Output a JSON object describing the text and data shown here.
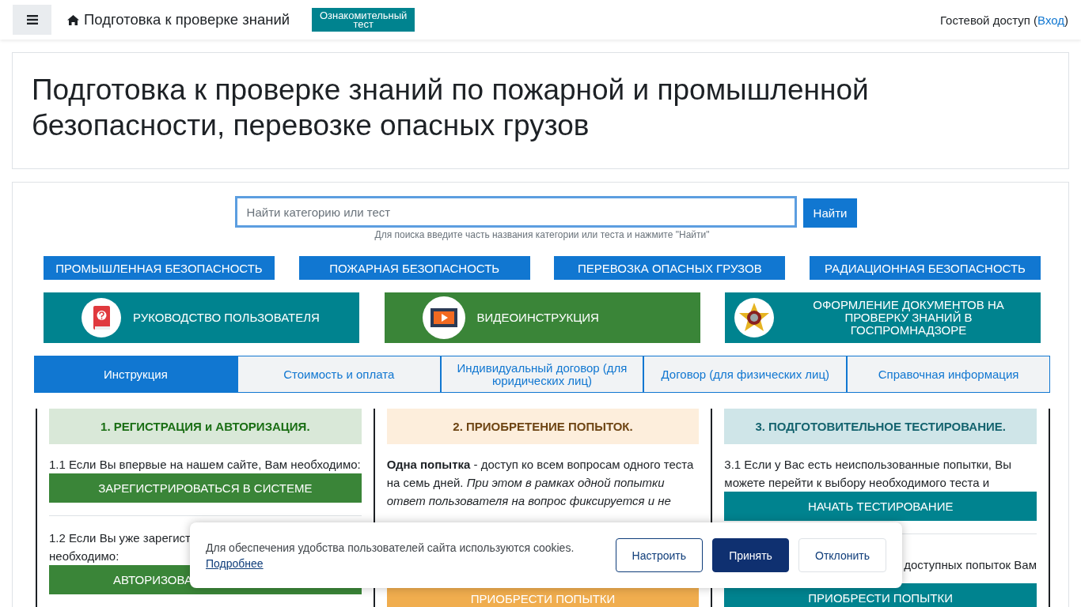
{
  "header": {
    "title": "Подготовка к проверке знаний",
    "badge": "Ознакомительный тест",
    "guest_prefix": "Гостевой доступ (",
    "login_link": "Вход",
    "guest_suffix": ")"
  },
  "hero": {
    "title": "Подготовка к проверке знаний по пожарной и промышленной безопасности, перевозке опасных грузов"
  },
  "search": {
    "placeholder": "Найти категорию или тест",
    "button": "Найти",
    "hint": "Для поиска введите часть названия категории или теста и нажмите \"Найти\""
  },
  "categories": [
    "ПРОМЫШЛЕННАЯ БЕЗОПАСНОСТЬ",
    "ПОЖАРНАЯ БЕЗОПАСНОСТЬ",
    "ПЕРЕВОЗКА ОПАСНЫХ ГРУЗОВ",
    "РАДИАЦИОННАЯ БЕЗОПАСНОСТЬ"
  ],
  "feature_buttons": [
    {
      "kind": "book",
      "label": "РУКОВОДСТВО ПОЛЬЗОВАТЕЛЯ",
      "color": "#00838f"
    },
    {
      "kind": "video",
      "label": "ВИДЕОИНСТРУКЦИЯ",
      "color": "#3a8538"
    },
    {
      "kind": "emblem",
      "label": "ОФОРМЛЕНИЕ ДОКУМЕНТОВ НА ПРОВЕРКУ ЗНАНИЙ В ГОСПРОМНАДЗОРЕ",
      "color": "#00838f"
    }
  ],
  "tabs": [
    {
      "label": "Инструкция",
      "selected": true
    },
    {
      "label": "Стоимость и оплата",
      "selected": false
    },
    {
      "label": "Индивидуальный договор (для юридических лиц)",
      "selected": false
    },
    {
      "label": "Договор (для физических лиц)",
      "selected": false
    },
    {
      "label": "Справочная информация",
      "selected": false
    }
  ],
  "columns": [
    {
      "color": "#d9e8d8",
      "heading": "1. РЕГИСТРАЦИЯ и АВТОРИЗАЦИЯ.",
      "blocks": [
        {
          "kind": "text",
          "lines": [
            "1.1 Если Вы впервые на нашем сайте, Вам необходимо:"
          ]
        },
        {
          "kind": "button",
          "label": "ЗАРЕГИСТРИРОВАТЬСЯ В СИСТЕМЕ",
          "color": "#3a8538"
        },
        {
          "kind": "divider"
        },
        {
          "kind": "text",
          "lines": [
            "1.2 Если Вы уже зарегист",
            "необходимо:"
          ]
        },
        {
          "kind": "button",
          "label": "АВТОРИЗОВА",
          "color": "#3a8538"
        }
      ]
    },
    {
      "color": "#fdeedc",
      "heading": "2. ПРИОБРЕТЕНИЕ ПОПЫТОК.",
      "blocks": [
        {
          "kind": "rich",
          "text": "**Одна попытка** - доступ ко всем вопросам одного теста на семь дней. *При этом в рамках одной попытки ответ пользователя на вопрос фиксируется и не*"
        },
        {
          "kind": "button",
          "label": "ПРИОБРЕСТИ ПОПЫТКИ",
          "color": "#f0ad4e"
        }
      ]
    },
    {
      "color": "#cfe5e8",
      "heading": "3. ПОДГОТОВИТЕЛЬНОЕ ТЕСТИРОВАНИЕ.",
      "blocks": [
        {
          "kind": "text",
          "lines": [
            "3.1 Если у Вас есть неиспользованные попытки, Вы можете перейти к выбору необходимого теста и"
          ]
        },
        {
          "kind": "button",
          "label": "НАЧАТЬ ТЕСТИРОВАНИЕ",
          "color": "#00838f"
        },
        {
          "kind": "divider"
        },
        {
          "kind": "fragment",
          "lines": [
            "доступных попыток Вам"
          ]
        },
        {
          "kind": "button",
          "label": "ПРИОБРЕСТИ ПОПЫТКИ",
          "color": "#00838f"
        }
      ]
    }
  ],
  "cookie": {
    "text": "Для обеспечения удобства пользователей сайта используются cookies.",
    "link": "Подробнее",
    "buttons": [
      {
        "kind": "outline",
        "label": "Настроить"
      },
      {
        "kind": "primary",
        "label": "Принять"
      },
      {
        "kind": "plain",
        "label": "Отклонить"
      }
    ]
  }
}
